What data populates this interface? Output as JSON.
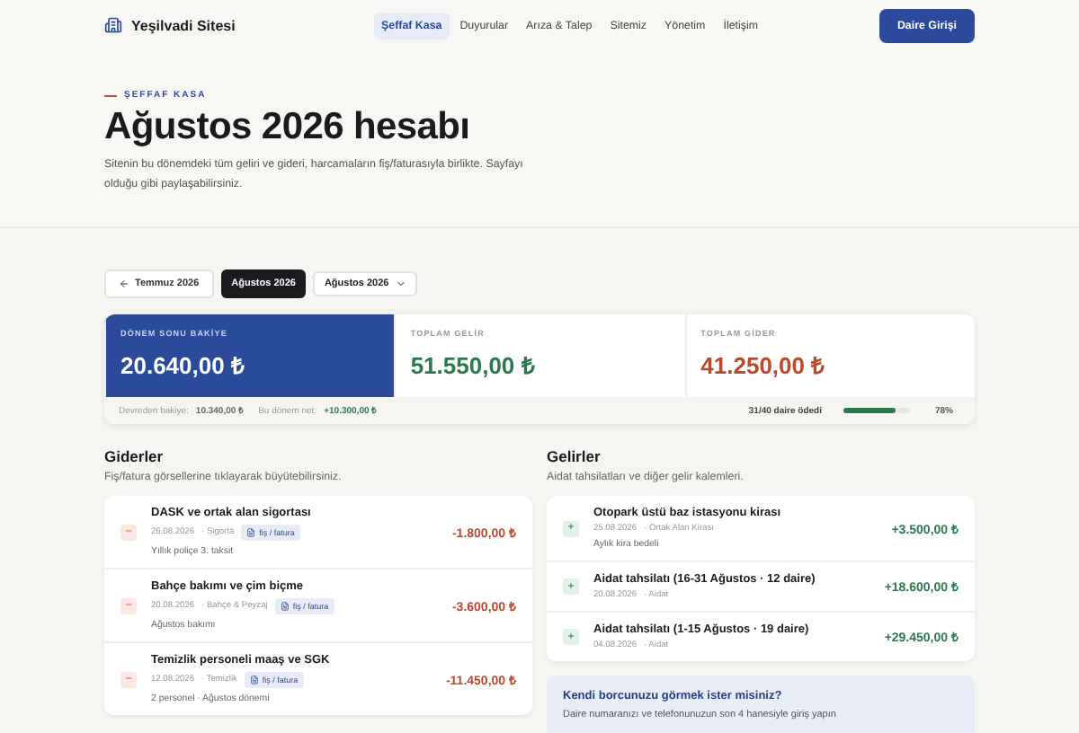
{
  "nav": {
    "brand": "Yeşilvadi Sitesi",
    "links": [
      {
        "label": "Şeffaf Kasa",
        "selected": true
      },
      {
        "label": "Duyurular",
        "selected": false
      },
      {
        "label": "Arıza & Talep",
        "selected": false
      },
      {
        "label": "Sitemiz",
        "selected": false
      },
      {
        "label": "Yönetim",
        "selected": false
      },
      {
        "label": "İletişim",
        "selected": false
      }
    ],
    "login": "Daire Girişi"
  },
  "hero": {
    "eyebrow": "ŞEFFAF KASA",
    "title": "Ağustos 2026 hesabı",
    "description": "Sitenin bu dönemdeki tüm geliri ve gideri, harcamaların fiş/faturasıyla birlikte. Sayfayı olduğu gibi paylaşabilirsiniz."
  },
  "period": {
    "previous": "Temmuz 2026",
    "current": "Ağustos 2026",
    "select": "Ağustos 2026"
  },
  "stats": [
    {
      "kind": "balance",
      "label": "DÖNEM SONU BAKİYE",
      "value": "20.640,00 ₺"
    },
    {
      "kind": "income",
      "label": "TOPLAM GELİR",
      "value": "51.550,00 ₺"
    },
    {
      "kind": "expense",
      "label": "TOPLAM GİDER",
      "value": "41.250,00 ₺"
    }
  ],
  "summary": {
    "carried_label": "Devreden bakiye:",
    "carried": "10.340,00 ₺",
    "net_label": "Bu dönem net:",
    "net": "+10.300,00 ₺",
    "paid": "31/40 daire ödedi",
    "level": 0.78,
    "percent": "78%"
  },
  "expenses": {
    "title": "Giderler",
    "subtitle": "Fiş/fatura görsellerine tıklayarak büyütebilirsiniz.",
    "items": [
      {
        "sign": "–",
        "title": "DASK ve ortak alan sigortası",
        "date": "26.08.2026",
        "category": "· Sigorta",
        "receipt": "fiş / fatura",
        "note": "Yıllık poliçe 3. taksit",
        "amount": "-1.800,00 ₺"
      },
      {
        "sign": "–",
        "title": "Bahçe bakımı ve çim biçme",
        "date": "20.08.2026",
        "category": "· Bahçe & Peyzaj",
        "receipt": "fiş / fatura",
        "note": "Ağustos bakımı",
        "amount": "-3.600,00 ₺"
      },
      {
        "sign": "–",
        "title": "Temizlik personeli maaş ve SGK",
        "date": "12.08.2026",
        "category": "· Temizlik",
        "receipt": "fiş / fatura",
        "note": "2 personel · Ağustos dönemi",
        "amount": "-11.450,00 ₺"
      }
    ]
  },
  "incomes": {
    "title": "Gelirler",
    "subtitle": "Aidat tahsilatları ve diğer gelir kalemleri.",
    "items": [
      {
        "sign": "+",
        "title": "Otopark üstü baz istasyonu kirası",
        "date": "25.08.2026",
        "category": "· Ortak Alan Kirası",
        "note": "Aylık kira bedeli",
        "amount": "+3.500,00 ₺"
      },
      {
        "sign": "+",
        "title": "Aidat tahsilatı (16-31 Ağustos · 12 daire)",
        "date": "20.08.2026",
        "category": "· Aidat",
        "amount": "+18.600,00 ₺"
      },
      {
        "sign": "+",
        "title": "Aidat tahsilatı (1-15 Ağustos · 19 daire)",
        "date": "04.08.2026",
        "category": "· Aidat",
        "amount": "+29.450,00 ₺"
      }
    ]
  },
  "cta": {
    "title": "Kendi borcunuzu görmek ister misiniz?",
    "text": "Daire numaranızı ve telefonunuzun son 4 hanesiyle giriş yapın"
  }
}
